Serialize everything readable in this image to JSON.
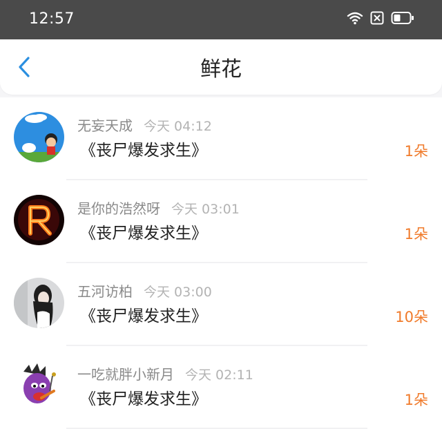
{
  "status_bar": {
    "time": "12:57",
    "icons": [
      "wifi-icon",
      "close-box-icon",
      "battery-icon"
    ]
  },
  "header": {
    "title": "鲜花",
    "back_icon": "chevron-left-icon"
  },
  "colors": {
    "accent_blue": "#2b8fe0",
    "count_orange": "#f07a2a",
    "status_bar_bg": "#4a4a4a"
  },
  "items": [
    {
      "name": "无妄天成",
      "time": "今天 04:12",
      "book": "《丧尸爆发求生》",
      "count": "1朵"
    },
    {
      "name": "是你的浩然呀",
      "time": "今天 03:01",
      "book": "《丧尸爆发求生》",
      "count": "1朵"
    },
    {
      "name": "五河访柏",
      "time": "今天 03:00",
      "book": "《丧尸爆发求生》",
      "count": "10朵"
    },
    {
      "name": "一吃就胖小新月",
      "time": "今天 02:11",
      "book": "《丧尸爆发求生》",
      "count": "1朵"
    }
  ]
}
